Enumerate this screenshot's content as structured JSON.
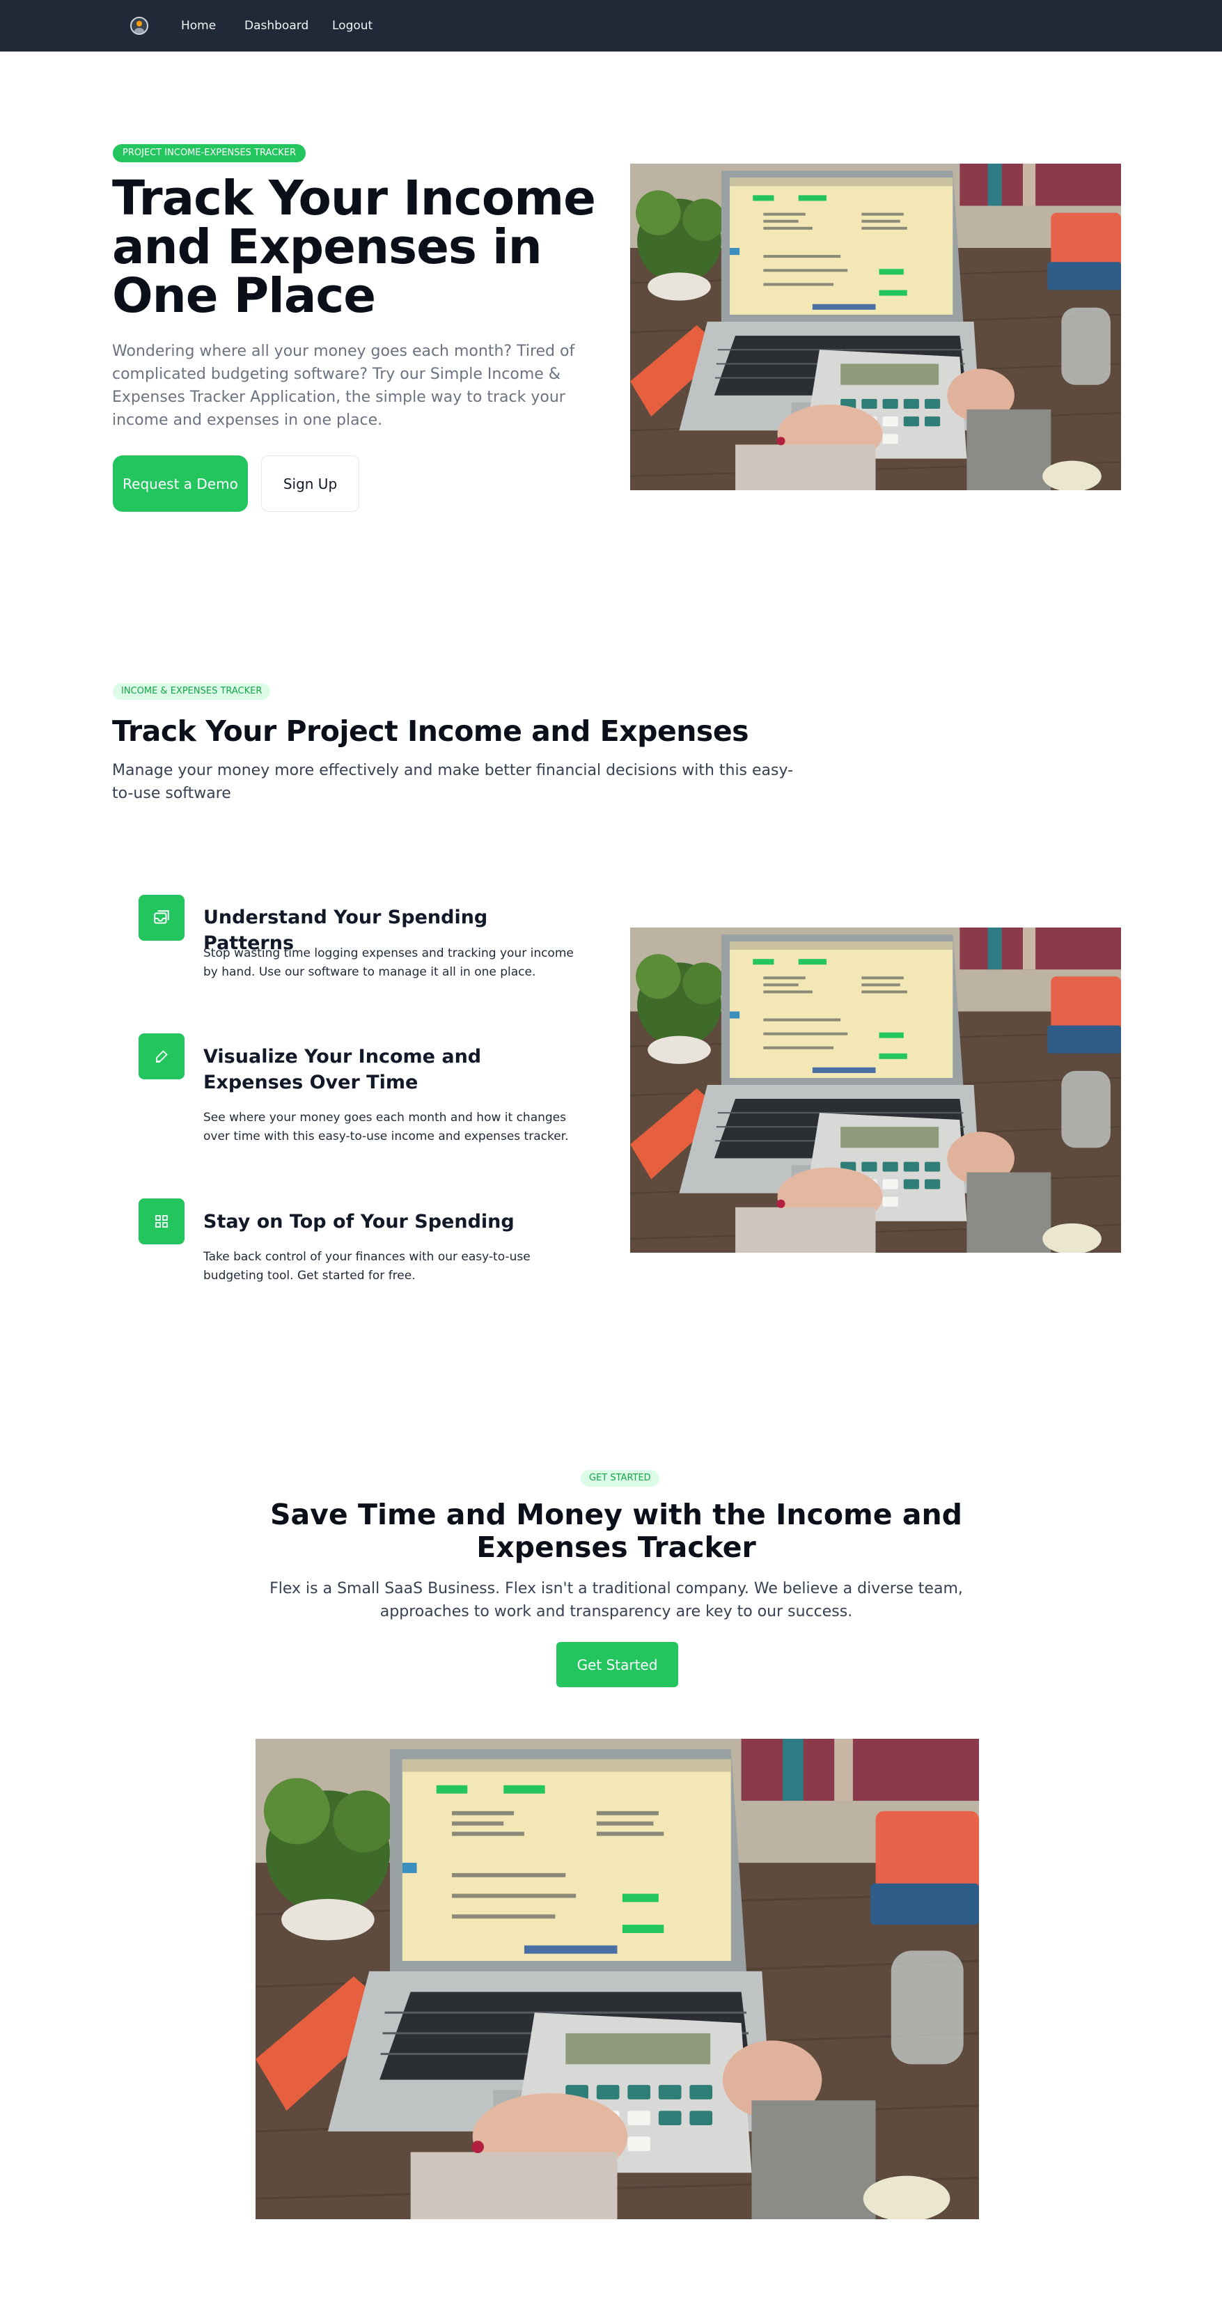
{
  "nav": {
    "links": [
      "Home",
      "Dashboard",
      "Logout"
    ],
    "logo_icon": "user-avatar-icon"
  },
  "hero": {
    "badge": "PROJECT INCOME-EXPENSES TRACKER",
    "title": "Track Your Income and Expenses in One Place",
    "description": "Wondering where all your money goes each month? Tired of complicated budgeting software? Try our Simple Income & Expenses Tracker Application, the simple way to track your income and expenses in one place.",
    "primary_button": "Request a Demo",
    "secondary_button": "Sign Up"
  },
  "features_section": {
    "badge": "INCOME & EXPENSES TRACKER",
    "title": "Track Your Project Income and Expenses",
    "description": "Manage your money more effectively and make better financial decisions with this easy-to-use software",
    "features": [
      {
        "icon": "inbox-icon",
        "title": "Understand Your Spending Patterns",
        "description": "Stop wasting time logging expenses and tracking your income by hand. Use our software to manage it all in one place."
      },
      {
        "icon": "pencil-icon",
        "title": "Visualize Your Income and Expenses Over Time",
        "description": "See where your money goes each month and how it changes over time with this easy-to-use income and expenses tracker."
      },
      {
        "icon": "grid-icon",
        "title": "Stay on Top of Your Spending",
        "description": "Take back control of your finances with our easy-to-use budgeting tool. Get started for free."
      }
    ]
  },
  "get_started": {
    "badge": "GET STARTED",
    "title": "Save Time and Money with the Income and Expenses Tracker",
    "description": "Flex is a Small SaaS Business. Flex isn't a traditional company. We believe a diverse team, approaches to work and transparency are key to our success.",
    "button": "Get Started"
  },
  "colors": {
    "accent": "#22c55e",
    "nav_bg": "#1f2937",
    "badge_soft_bg": "#dcfce7"
  }
}
